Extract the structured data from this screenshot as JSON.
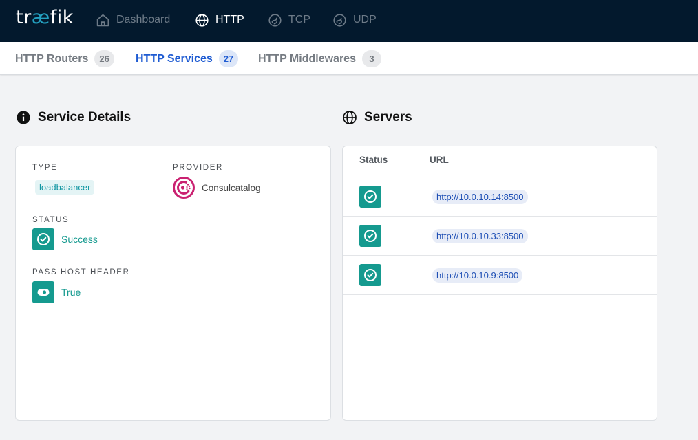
{
  "brand": {
    "logo_pre": "tr",
    "logo_ae": "æ",
    "logo_post": "fik"
  },
  "topnav": [
    {
      "label": "Dashboard",
      "icon": "home-icon",
      "active": false
    },
    {
      "label": "HTTP",
      "icon": "globe-icon",
      "active": true
    },
    {
      "label": "TCP",
      "icon": "tcp-icon",
      "active": false
    },
    {
      "label": "UDP",
      "icon": "udp-icon",
      "active": false
    }
  ],
  "tabs": [
    {
      "label": "HTTP Routers",
      "count": "26",
      "active": false
    },
    {
      "label": "HTTP Services",
      "count": "27",
      "active": true
    },
    {
      "label": "HTTP Middlewares",
      "count": "3",
      "active": false
    }
  ],
  "details": {
    "title": "Service Details",
    "type_label": "TYPE",
    "type_value": "loadbalancer",
    "provider_label": "PROVIDER",
    "provider_value": "Consulcatalog",
    "status_label": "STATUS",
    "status_value": "Success",
    "pass_host_header_label": "PASS HOST HEADER",
    "pass_host_header_value": "True"
  },
  "servers": {
    "title": "Servers",
    "col_status": "Status",
    "col_url": "URL",
    "rows": [
      {
        "url": "http://10.0.10.14:8500"
      },
      {
        "url": "http://10.0.10.33:8500"
      },
      {
        "url": "http://10.0.10.9:8500"
      }
    ]
  },
  "colors": {
    "nav_bg": "#03192d",
    "accent_blue": "#1e5bd2",
    "success_teal": "#159a8f",
    "brand_ae": "#24a1c1"
  }
}
